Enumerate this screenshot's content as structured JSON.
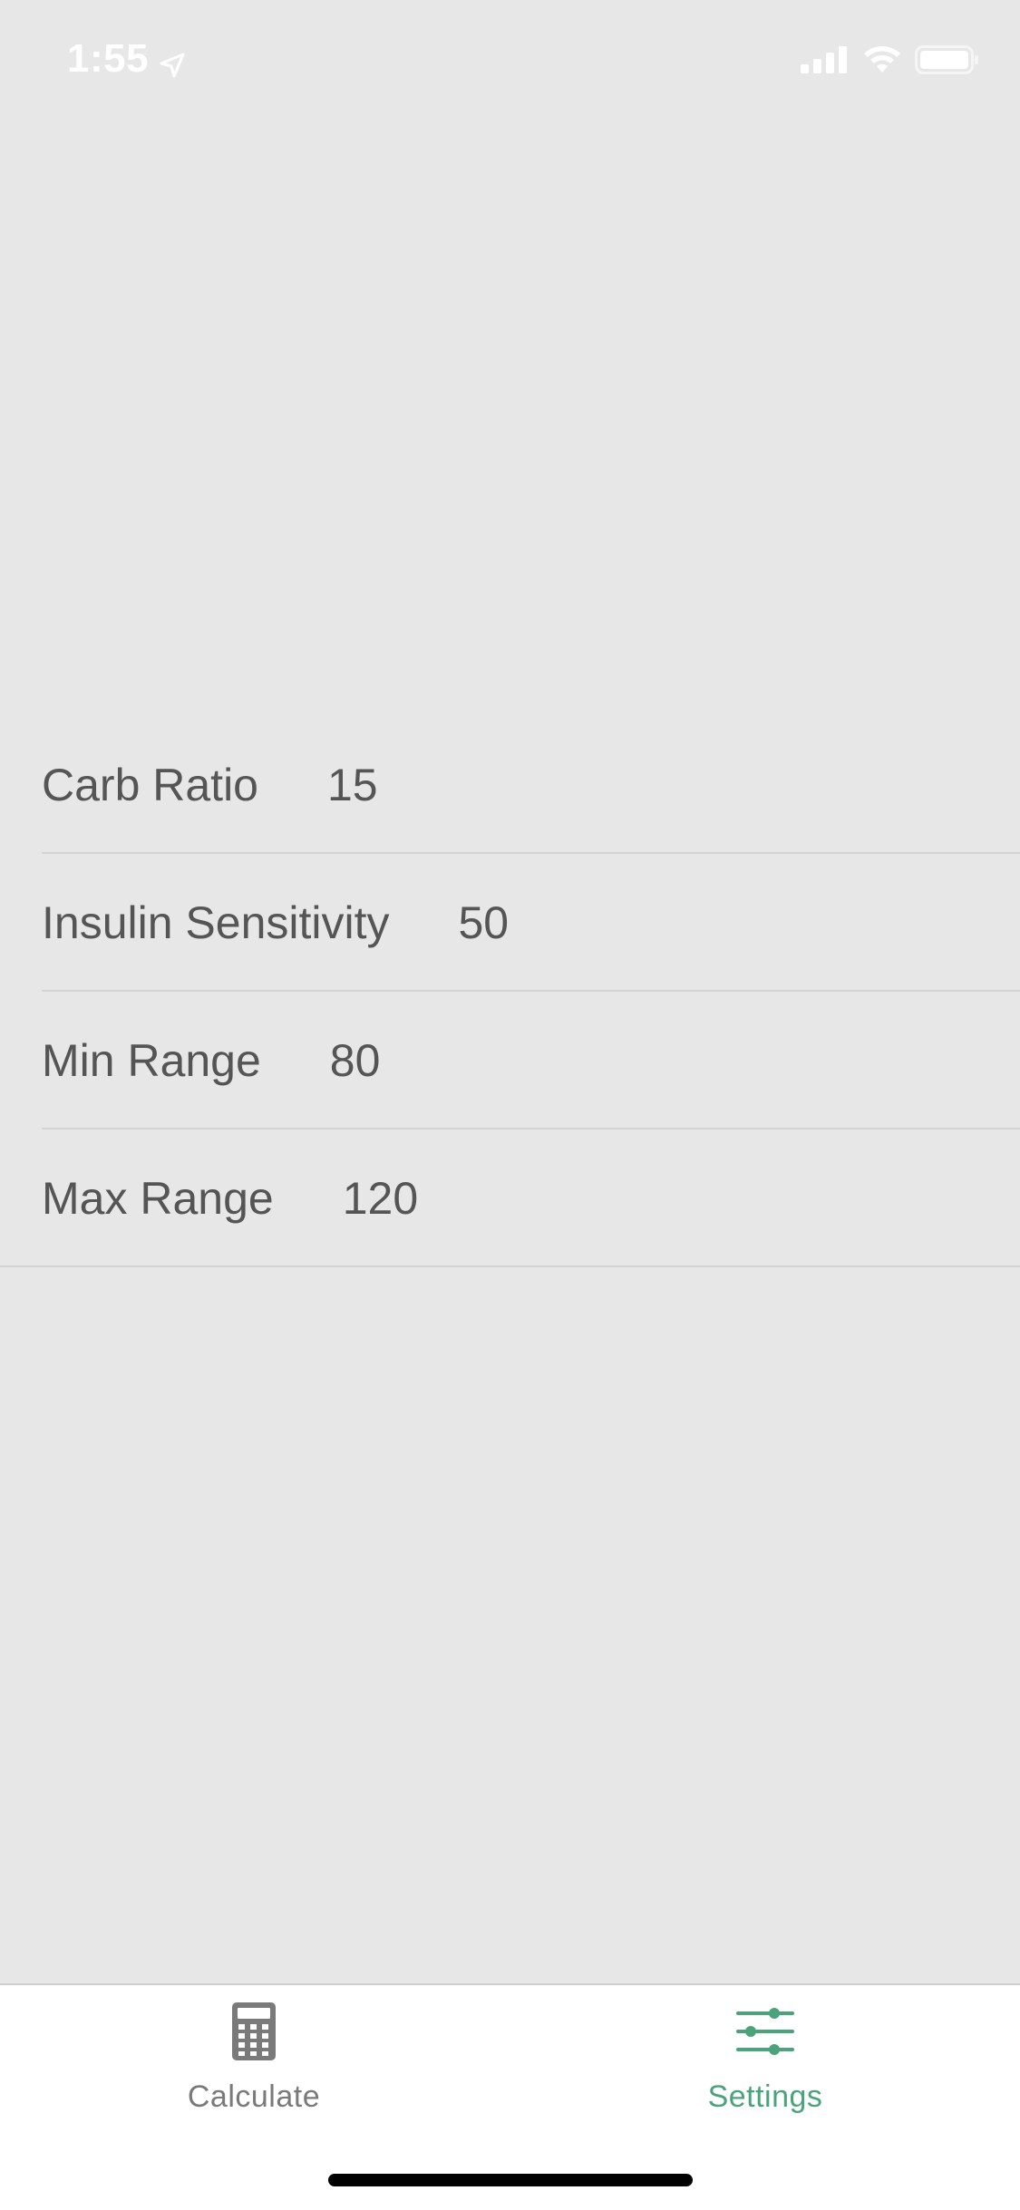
{
  "status_bar": {
    "time": "1:55",
    "location_icon": "location-arrow-icon",
    "signal_icon": "cellular-signal-icon",
    "wifi_icon": "wifi-icon",
    "battery_icon": "battery-icon"
  },
  "settings": {
    "carb_ratio": {
      "label": "Carb Ratio",
      "value": "15"
    },
    "insulin_sensitivity": {
      "label": "Insulin Sensitivity",
      "value": "50"
    },
    "min_range": {
      "label": "Min Range",
      "value": "80"
    },
    "max_range": {
      "label": "Max Range",
      "value": "120"
    }
  },
  "tab_bar": {
    "calculate": {
      "label": "Calculate",
      "icon": "calculator-icon",
      "active": false
    },
    "settings": {
      "label": "Settings",
      "icon": "sliders-icon",
      "active": true
    }
  },
  "colors": {
    "background": "#e7e7e7",
    "text": "#555555",
    "accent": "#4aa37a",
    "inactive_tab": "#7a7a7a"
  }
}
